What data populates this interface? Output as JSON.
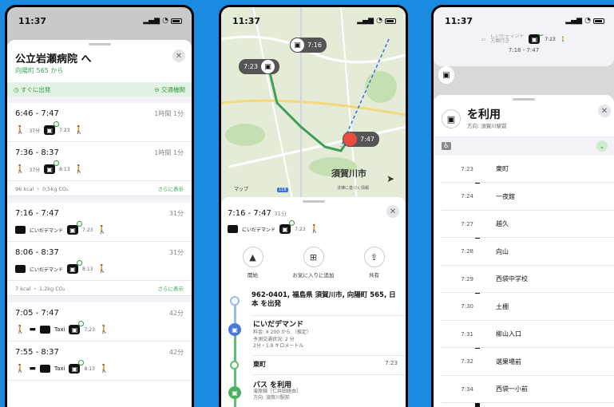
{
  "status": {
    "time": "11:37"
  },
  "screen1": {
    "dest": "公立岩瀬病院 へ",
    "from": "向陽町 565 から",
    "depart_now": "すぐに出発",
    "transit": "交通機関",
    "routes": [
      {
        "time": "6:46 - 7:47",
        "dur": "1時間 1分",
        "walk1": "37分",
        "bus": "7:23"
      },
      {
        "time": "7:36 - 8:37",
        "dur": "1時間 1分",
        "walk1": "37分",
        "bus": "8:13"
      }
    ],
    "kcal1": "96 kcal ・ 0,5kg CO₂",
    "kcal2": "7 kcal ・ 1,2kg CO₂",
    "more": "さらに表示",
    "routes2": [
      {
        "time": "7:16 - 7:47",
        "dur": "31分",
        "demand": "にいだデマンド",
        "bus": "7:23"
      },
      {
        "time": "8:06 - 8:37",
        "dur": "31分",
        "demand": "にいだデマンド",
        "bus": "8:13"
      }
    ],
    "routes3": [
      {
        "time": "7:05 - 7:47",
        "dur": "42分",
        "taxi": "Taxi",
        "bus": "7:23"
      },
      {
        "time": "7:55 - 8:37",
        "dur": "42分",
        "taxi": "Taxi",
        "bus": "8:13"
      }
    ]
  },
  "screen2": {
    "pin1": "7:16",
    "pin2": "7:23",
    "pin3": "7:47",
    "city": "須賀川市",
    "maps_logo": "マップ",
    "legal": "法律に基づく情報",
    "road": "118",
    "time": "7:16 - 7:47",
    "dur": "31分",
    "demand": "にいだデマンド",
    "bus": "7:23",
    "actions": [
      "開始",
      "お気に入りに追加",
      "共有"
    ],
    "address": "962-0401, 福島県 須賀川市, 向陽町 565, 日本 を出発",
    "demand_title": "にいだデマンド",
    "fare": "料金: ¥ 200 から （推定）",
    "wait": "予測交通状況: 2 分",
    "dist": "2分・1.9 キロメートル",
    "stop": "東町",
    "stop_time": "7:23",
    "bus_title": "バス を利用",
    "bus_line": "滝原線［仁井田経由］",
    "bus_dir": "方向: 須賀川駅前"
  },
  "screen3": {
    "top_demand": "にいだデマンド",
    "top_sub": "方面行き",
    "top_bus": "7:23",
    "top_time": "7:18 - 7:47",
    "title": "を利用",
    "dir": "方向: 須賀川駅前",
    "stops": [
      {
        "t": "7:23",
        "n": "東町"
      },
      {
        "t": "7:24",
        "n": "一夜館"
      },
      {
        "t": "7:27",
        "n": "越久"
      },
      {
        "t": "7:28",
        "n": "向山"
      },
      {
        "t": "7:29",
        "n": "西袋中学校"
      },
      {
        "t": "7:30",
        "n": "土棚"
      },
      {
        "t": "7:31",
        "n": "柳山入口"
      },
      {
        "t": "7:32",
        "n": "選果場前"
      },
      {
        "t": "7:34",
        "n": "西袋一小前"
      }
    ]
  }
}
